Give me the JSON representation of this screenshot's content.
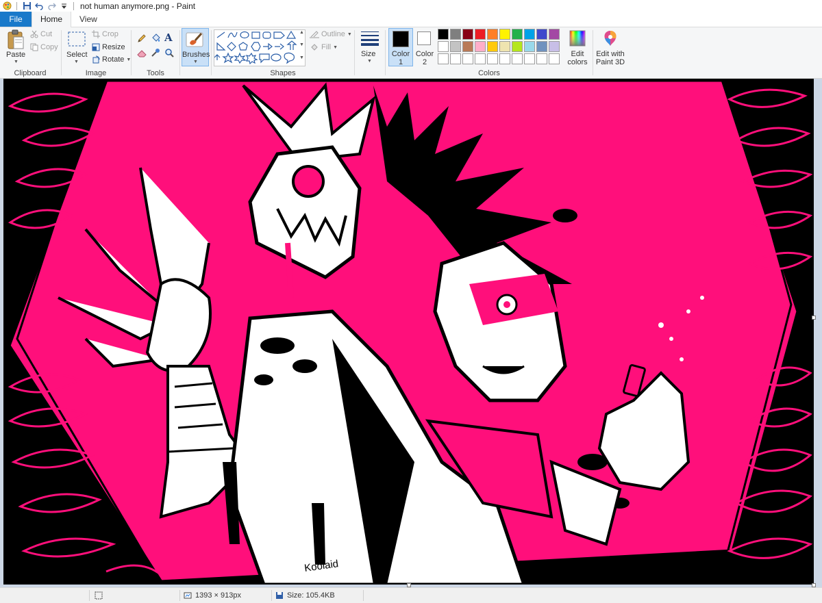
{
  "window": {
    "title": "not human anymore.png - Paint"
  },
  "tabs": {
    "file": "File",
    "home": "Home",
    "view": "View"
  },
  "clipboard": {
    "paste": "Paste",
    "cut": "Cut",
    "copy": "Copy",
    "label": "Clipboard"
  },
  "image": {
    "select": "Select",
    "crop": "Crop",
    "resize": "Resize",
    "rotate": "Rotate",
    "label": "Image"
  },
  "tools": {
    "label": "Tools",
    "text_glyph": "A"
  },
  "brushes": {
    "label": "Brushes"
  },
  "shapes": {
    "outline": "Outline",
    "fill": "Fill",
    "label": "Shapes"
  },
  "size": {
    "label": "Size"
  },
  "colors": {
    "color1_label": "Color",
    "color1_num": "1",
    "color2_label": "Color",
    "color2_num": "2",
    "edit_label": "Edit",
    "edit_label2": "colors",
    "paint3d_label": "Edit with",
    "paint3d_label2": "Paint 3D",
    "label": "Colors",
    "color1_value": "#000000",
    "color2_value": "#ffffff",
    "palette": [
      "#000000",
      "#7f7f7f",
      "#880015",
      "#ed1c24",
      "#ff7f27",
      "#fff200",
      "#22b14c",
      "#00a2e8",
      "#3f48cc",
      "#a349a4",
      "#ffffff",
      "#c3c3c3",
      "#b97a57",
      "#ffaec9",
      "#ffc90e",
      "#efe4b0",
      "#b5e61d",
      "#99d9ea",
      "#7092be",
      "#c8bfe7",
      "#ffffff",
      "#ffffff",
      "#ffffff",
      "#ffffff",
      "#ffffff",
      "#ffffff",
      "#ffffff",
      "#ffffff",
      "#ffffff",
      "#ffffff"
    ]
  },
  "artwork": {
    "signature": "Koolaid",
    "accent": "#ff0f7b"
  },
  "status": {
    "dimensions": "1393 × 913px",
    "size": "Size: 105.4KB"
  }
}
